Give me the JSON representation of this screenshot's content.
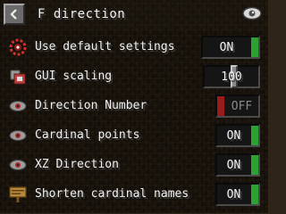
{
  "header": {
    "title": "F direction",
    "back_icon": "chevron-left-icon",
    "right_icon": "eye-icon"
  },
  "colors": {
    "on": "#2ea133",
    "off": "#9a1b1b"
  },
  "settings": [
    {
      "label": "Use default settings",
      "icon": "cog-red-icon",
      "control": "toggle",
      "value": "ON",
      "state": true
    },
    {
      "label": "GUI scaling",
      "icon": "scale-icon",
      "control": "slider",
      "value": "100",
      "fraction": 0.55
    },
    {
      "label": "Direction Number",
      "icon": "eye-icon",
      "control": "toggle",
      "value": "OFF",
      "state": false
    },
    {
      "label": "Cardinal points",
      "icon": "eye-icon",
      "control": "toggle",
      "value": "ON",
      "state": true
    },
    {
      "label": "XZ Direction",
      "icon": "eye-icon",
      "control": "toggle",
      "value": "ON",
      "state": true
    },
    {
      "label": "Shorten cardinal names",
      "icon": "sign-icon",
      "control": "toggle",
      "value": "ON",
      "state": true
    }
  ]
}
